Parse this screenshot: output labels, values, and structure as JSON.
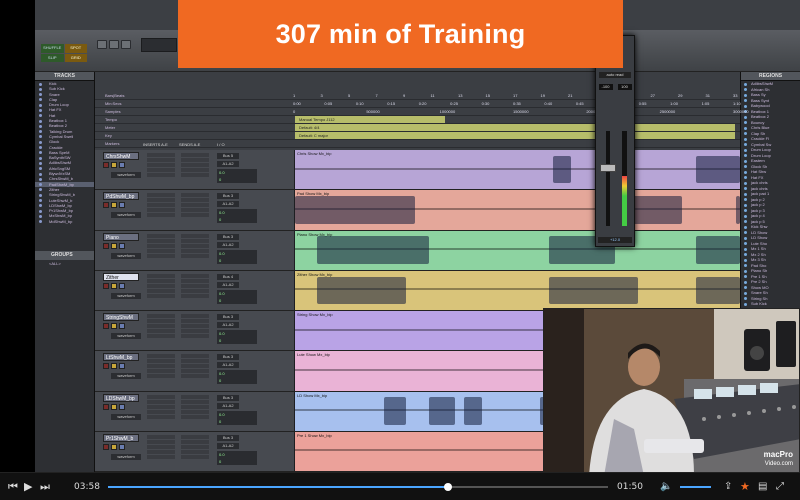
{
  "banner": {
    "text": "307 min of Training"
  },
  "toolbar": {
    "mode_labels": [
      "SHUFFLE",
      "SPOT",
      "SLIP",
      "GRID"
    ]
  },
  "tracks_panel": {
    "title": "TRACKS",
    "names": [
      "Kick",
      "Sub Kick",
      "Snare",
      "Clap",
      "Drum Loop",
      "Hat FX",
      "Hat",
      "Beatbox 1",
      "Beatbox 2",
      "Talking Drum",
      "Cymbal Swell",
      "Glock",
      "Crackle",
      "Bass SpeM",
      "BaSynthSW",
      "AdlibsShwM",
      "AfricSngSM",
      "BlywdVxSM",
      "ChrsShwM_b",
      "PadShwM_bp",
      "Zither",
      "StringShwM_b",
      "LuteShwM_b",
      "LDShwM_bp",
      "Pr1ShwM_bp",
      "MxShwM_bp",
      "MdShwM_bp"
    ],
    "selected_index": 19
  },
  "groups_panel": {
    "title": "GROUPS",
    "items": [
      "<ALL>"
    ]
  },
  "regions_panel": {
    "title": "REGIONS",
    "items": [
      "AdlibsShwM",
      "African Sh",
      "Bass Sy",
      "Bass Synt",
      "Babywood",
      "Beatbox 1",
      "Beatbox 2",
      "Bouncy",
      "Chris Blue",
      "Clap Sh",
      "Crackle Fl",
      "Cymbal Sw",
      "Drum Loop",
      "Drum Loop",
      "Eastern",
      "Glock Sh",
      "Hat Shw",
      "Hat FX",
      "jack chris",
      "jack chris",
      "jack pad 1",
      "jack p 2",
      "jack p 2",
      "jack p 3",
      "jack p 4",
      "jack p 5",
      "Kick Shw",
      "LD Show",
      "LD Show",
      "Lute Sho",
      "Mx 1 Sh",
      "Mx 2 Sh",
      "Mx 3 Sh",
      "Pad Sho",
      "Piano Sh",
      "Pre 1 Sh",
      "Pre 2 Sh",
      "Show MO",
      "Snare Sh",
      "String Sh",
      "Sub Kick",
      "Talking",
      "Zither Sh"
    ]
  },
  "rulers": {
    "rows": [
      "Bars|Beats",
      "Min:Secs",
      "Samples",
      "Tempo",
      "Meter",
      "Key",
      "Markers"
    ],
    "bar_ticks": [
      "1",
      "3",
      "5",
      "7",
      "9",
      "11",
      "13",
      "15",
      "17",
      "19",
      "21",
      "23",
      "25",
      "27",
      "29",
      "31",
      "33"
    ],
    "min_ticks": [
      "0:00",
      "0:05",
      "0:10",
      "0:15",
      "0:20",
      "0:25",
      "0:30",
      "0:35",
      "0:40",
      "0:45",
      "0:50",
      "0:55",
      "1:00",
      "1:05",
      "1:10"
    ],
    "sample_ticks": [
      "0",
      "500000",
      "1000000",
      "1500000",
      "2000000",
      "2500000",
      "3000000"
    ],
    "tempo": "Manual Tempo  J112",
    "meter": "Default: 4/4",
    "key": "Default: C major"
  },
  "edit_header": {
    "inserts": "INSERTS A-E",
    "sends": "SENDS A-E",
    "io": "I / O"
  },
  "mixer_strip": {
    "label_top": "Bass",
    "label_mid": "Auto",
    "mode": "auto read",
    "pan_l": "-100",
    "pan_r": "100",
    "level": "+12.0",
    "safe": "SAFE"
  },
  "edit_tracks": [
    {
      "name": "ChrsShwM",
      "clip": "Chris Show Mx_bip",
      "color": "#b7a5d6",
      "view": "waveform",
      "vol": "0.0",
      "pan": "0",
      "io1": "Bus 5",
      "io2": "A1-A2"
    },
    {
      "name": "PdShwM_bp",
      "clip": "Pad Show Mx_bip",
      "color": "#e4a79a",
      "view": "waveform",
      "vol": "0.0",
      "pan": "0",
      "io1": "Bus 3",
      "io2": "A1-A2"
    },
    {
      "name": "Piano",
      "clip": "Piano Show Mx_bip",
      "color": "#8dd3a1",
      "view": "waveform",
      "vol": "0.0",
      "pan": "0",
      "io1": "Bus 3",
      "io2": "A1-A2"
    },
    {
      "name": "Zither",
      "clip": "Zither Show Mx_bip",
      "color": "#d9c47a",
      "view": "waveform",
      "vol": "0.0",
      "pan": "0",
      "io1": "Bus 4",
      "io2": "A1-A2"
    },
    {
      "name": "StringShwM",
      "clip": "String Show Mx_bip",
      "color": "#b9a3e6",
      "view": "waveform",
      "vol": "0.0",
      "pan": "0",
      "io1": "Bus 3",
      "io2": "A1-A2"
    },
    {
      "name": "LtShwM_bp",
      "clip": "Lute Show Mx_bip",
      "color": "#eab3d6",
      "view": "waveform",
      "vol": "0.0",
      "pan": "0",
      "io1": "Bus 3",
      "io2": "A1-A2"
    },
    {
      "name": "LDShwM_bp",
      "clip": "LD Show Mx_bip",
      "color": "#a7c0ee",
      "view": "waveform",
      "vol": "0.0",
      "pan": "0",
      "io1": "Bus 3",
      "io2": "A1-A2"
    },
    {
      "name": "Pr1ShwM_b",
      "clip": "Pre 1 Show Mx_bip",
      "color": "#eba19a",
      "view": "waveform",
      "vol": "0.0",
      "pan": "0",
      "io1": "Bus 3",
      "io2": "A1-A2"
    }
  ],
  "video_inset": {
    "logo_line1": "macPro",
    "logo_line2": "Video.com"
  },
  "player": {
    "current_time": "03:58",
    "remaining_time": "01:50",
    "progress": 0.68,
    "volume": 0.85
  }
}
